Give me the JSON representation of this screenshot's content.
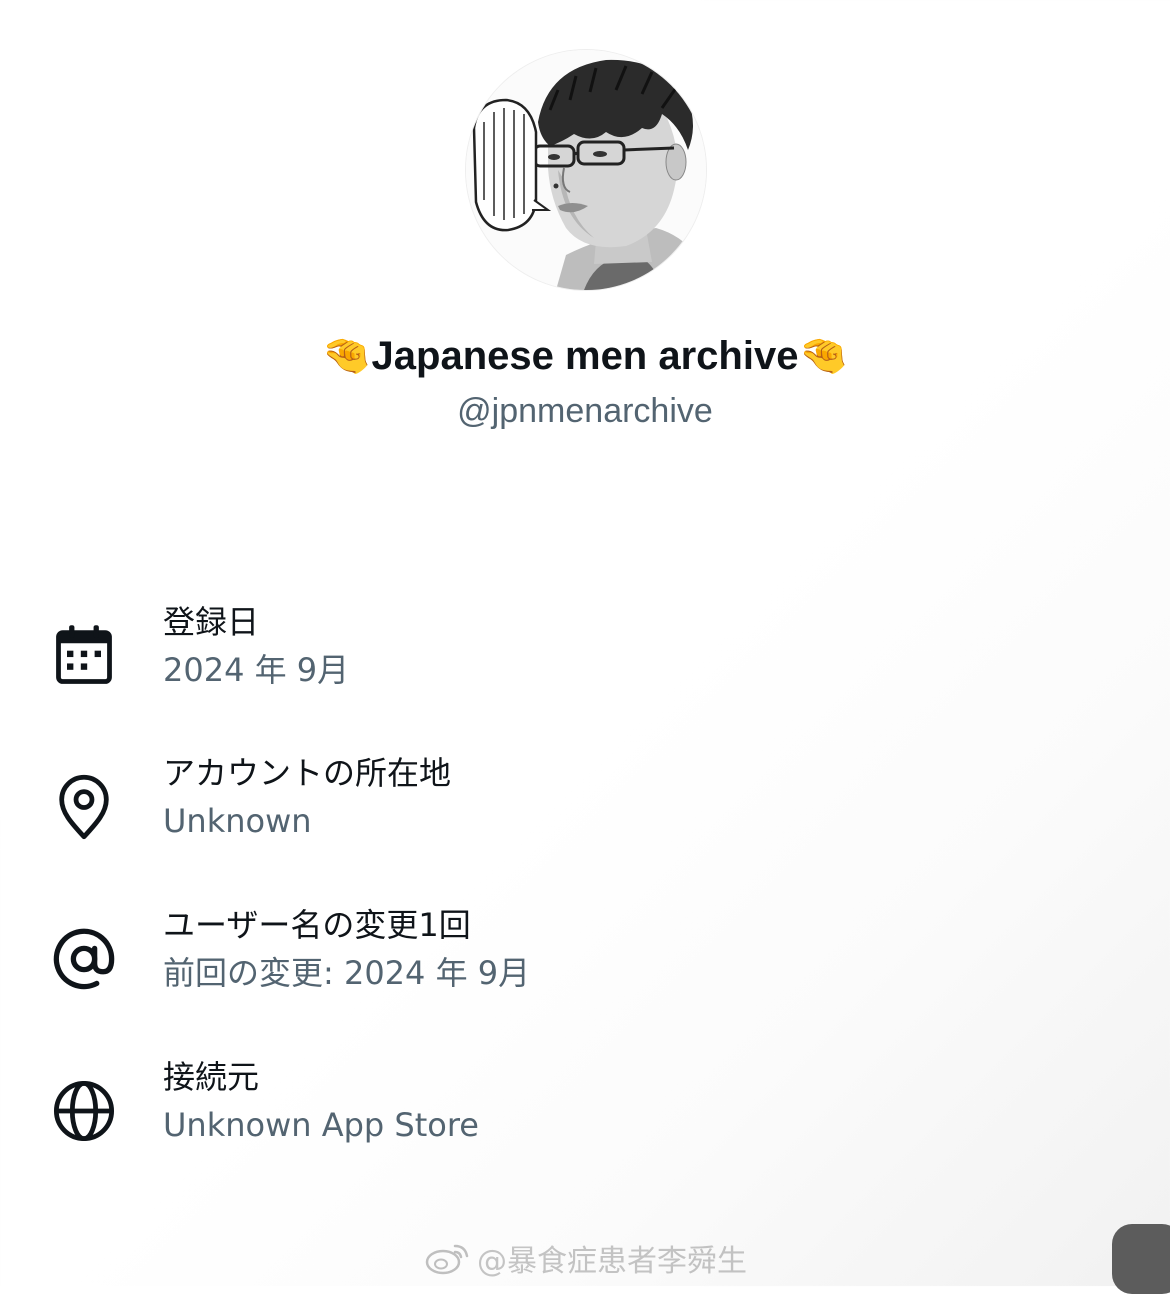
{
  "profile": {
    "avatar_icon": "avatar-illustration",
    "display_name": "🤏Japanese men archive🤏",
    "handle": "@jpnmenarchive"
  },
  "info": [
    {
      "icon": "calendar-icon",
      "label": "登録日",
      "value": "2024 年 9月"
    },
    {
      "icon": "location-pin-icon",
      "label": "アカウントの所在地",
      "value": "Unknown"
    },
    {
      "icon": "at-sign-icon",
      "label": "ユーザー名の変更1回",
      "value": "前回の変更: 2024 年 9月"
    },
    {
      "icon": "globe-icon",
      "label": "接続元",
      "value": "Unknown App Store"
    }
  ],
  "watermark": {
    "icon": "weibo-icon",
    "text": "@暴食症患者李舜生"
  },
  "colors": {
    "primary_text": "#0f1419",
    "secondary_text": "#536471"
  }
}
